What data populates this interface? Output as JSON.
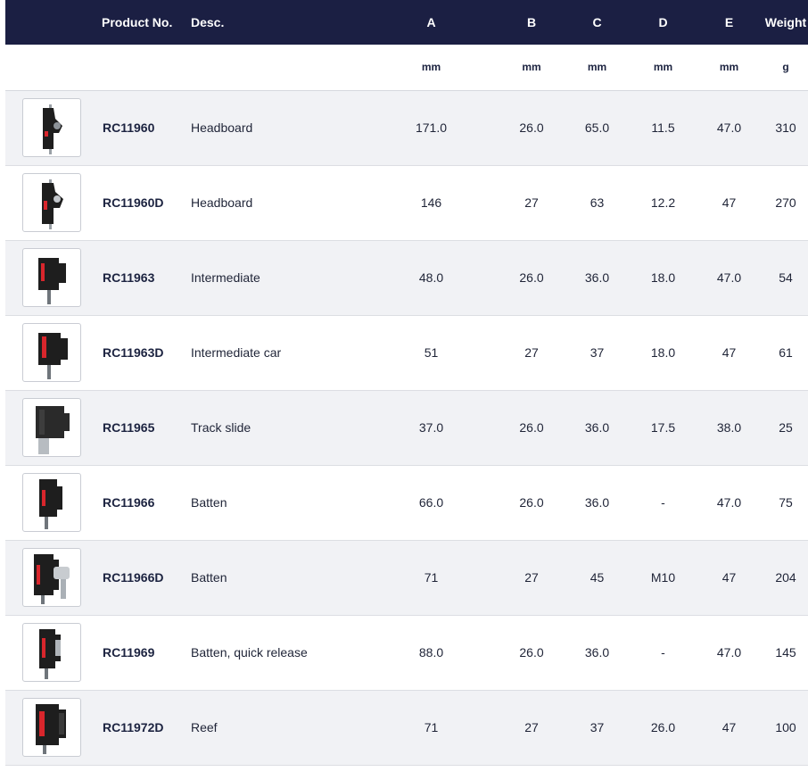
{
  "table": {
    "headers": {
      "product_no": "Product No.",
      "desc": "Desc.",
      "a": "A",
      "b": "B",
      "c": "C",
      "d": "D",
      "e": "E",
      "weight": "Weight"
    },
    "units": {
      "a": "mm",
      "b": "mm",
      "c": "mm",
      "d": "mm",
      "e": "mm",
      "weight": "g"
    },
    "rows": [
      {
        "product_no": "RC11960",
        "desc": "Headboard",
        "a": "171.0",
        "b": "26.0",
        "c": "65.0",
        "d": "11.5",
        "e": "47.0",
        "weight": "310",
        "thumb_icon": "headboard-car-icon"
      },
      {
        "product_no": "RC11960D",
        "desc": "Headboard",
        "a": "146",
        "b": "27",
        "c": "63",
        "d": "12.2",
        "e": "47",
        "weight": "270",
        "thumb_icon": "headboard-car-icon"
      },
      {
        "product_no": "RC11963",
        "desc": "Intermediate",
        "a": "48.0",
        "b": "26.0",
        "c": "36.0",
        "d": "18.0",
        "e": "47.0",
        "weight": "54",
        "thumb_icon": "intermediate-car-icon"
      },
      {
        "product_no": "RC11963D",
        "desc": "Intermediate car",
        "a": "51",
        "b": "27",
        "c": "37",
        "d": "18.0",
        "e": "47",
        "weight": "61",
        "thumb_icon": "intermediate-car-icon"
      },
      {
        "product_no": "RC11965",
        "desc": "Track slide",
        "a": "37.0",
        "b": "26.0",
        "c": "36.0",
        "d": "17.5",
        "e": "38.0",
        "weight": "25",
        "thumb_icon": "track-slide-icon"
      },
      {
        "product_no": "RC11966",
        "desc": "Batten",
        "a": "66.0",
        "b": "26.0",
        "c": "36.0",
        "d": "-",
        "e": "47.0",
        "weight": "75",
        "thumb_icon": "batten-car-icon"
      },
      {
        "product_no": "RC11966D",
        "desc": "Batten",
        "a": "71",
        "b": "27",
        "c": "45",
        "d": "M10",
        "e": "47",
        "weight": "204",
        "thumb_icon": "batten-car-icon"
      },
      {
        "product_no": "RC11969",
        "desc": "Batten, quick release",
        "a": "88.0",
        "b": "26.0",
        "c": "36.0",
        "d": "-",
        "e": "47.0",
        "weight": "145",
        "thumb_icon": "batten-car-icon"
      },
      {
        "product_no": "RC11972D",
        "desc": "Reef",
        "a": "71",
        "b": "27",
        "c": "37",
        "d": "26.0",
        "e": "47",
        "weight": "100",
        "thumb_icon": "reef-car-icon"
      }
    ]
  },
  "colors": {
    "header_bg": "#1b1f43",
    "header_text": "#ffffff",
    "row_alt_bg": "#f1f2f5",
    "accent_red": "#d9262c"
  }
}
